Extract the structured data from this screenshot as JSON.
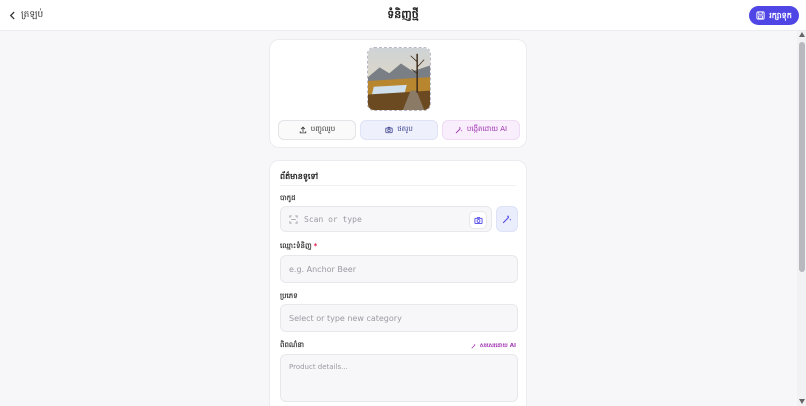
{
  "header": {
    "back_label": "ត្រឡប់",
    "title": "ទំនិញថ្មី",
    "save_label": "រក្សាទុក"
  },
  "media": {
    "upload_label": "បញ្ចូលរូប",
    "camera_label": "ថតរូប",
    "ai_label": "បង្កើតដោយ AI"
  },
  "form": {
    "section_title": "ព័ត៌មានទូទៅ",
    "barcode": {
      "label": "បាកូដ",
      "placeholder": "Scan or type"
    },
    "name": {
      "label": "ឈ្មោះទំនិញ",
      "required_mark": "*",
      "placeholder": "e.g. Anchor Beer"
    },
    "category": {
      "label": "ប្រភេទ",
      "placeholder": "Select or type new category"
    },
    "description": {
      "label": "ពិពណ៌នា",
      "ai_write_label": "សរសេរដោយ AI",
      "placeholder": "Product details..."
    }
  },
  "colors": {
    "accent": "#4f46e5",
    "ai": "#a33ab5",
    "required": "#e11d48"
  }
}
